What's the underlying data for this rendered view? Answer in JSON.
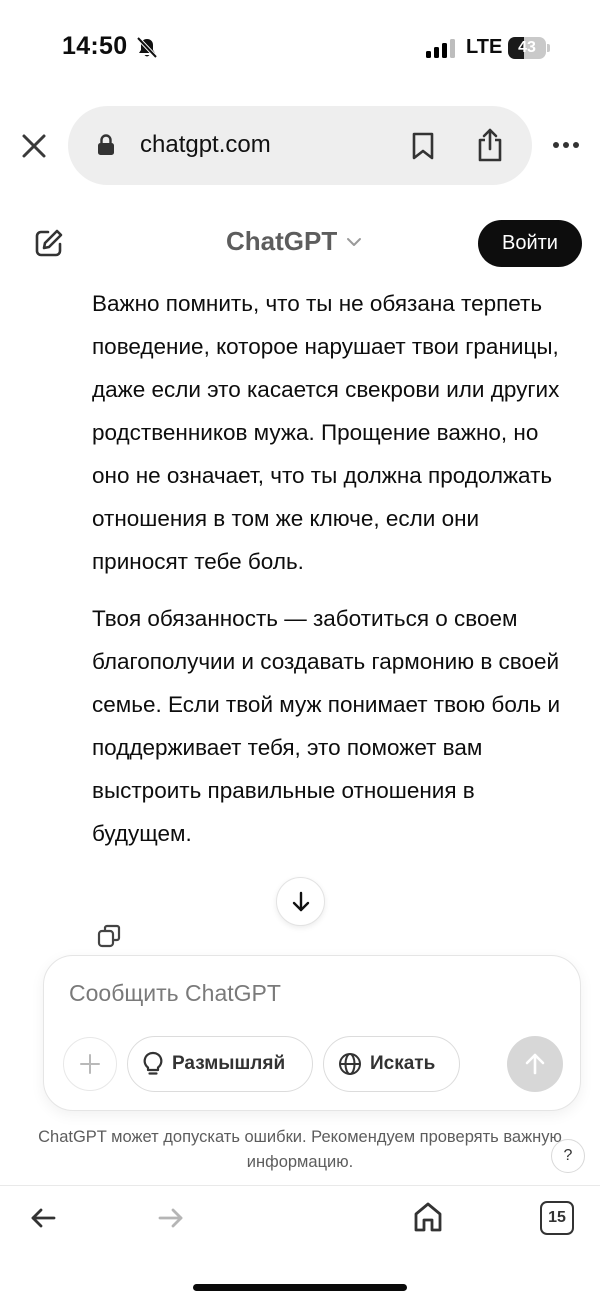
{
  "status_bar": {
    "time": "14:50",
    "network": "LTE",
    "battery_level": "43",
    "battery_fraction": 0.43
  },
  "browser": {
    "url": "chatgpt.com",
    "open_tabs": "15"
  },
  "header": {
    "title": "ChatGPT",
    "login_label": "Войти"
  },
  "message": {
    "paragraphs": [
      "Важно помнить, что ты не обязана терпеть поведение, которое нарушает твои границы, даже если это касается свекрови или других родственников мужа. Прощение важно, но оно не означает, что ты должна продолжать отношения в том же ключе, если они приносят тебе боль.",
      "Твоя обязанность — заботиться о своем благополучии и создавать гармонию в своей семье. Если твой муж понимает твою боль и поддерживает тебя, это поможет вам выстроить правильные отношения в будущем."
    ]
  },
  "composer": {
    "placeholder": "Сообщить ChatGPT",
    "think_label": "Размышляй",
    "search_label": "Искать"
  },
  "footer": {
    "disclaimer": "ChatGPT может допускать ошибки. Рекомендуем проверять важную информацию.",
    "help_label": "?"
  },
  "icons": {
    "close": "close-icon",
    "lock": "lock-icon",
    "bookmark": "bookmark-icon",
    "share": "share-icon",
    "more": "more-icon",
    "new_chat": "edit-icon",
    "chevron": "chevron-down-icon",
    "scroll_down": "arrow-down-icon",
    "copy": "copy-icon",
    "plus": "plus-icon",
    "bulb": "lightbulb-icon",
    "globe": "globe-icon",
    "send": "arrow-up-icon",
    "back": "arrow-left-icon",
    "forward": "arrow-right-icon",
    "home": "home-icon",
    "bell_off": "bell-slash-icon"
  },
  "colors": {
    "login_button": "#0d0d0d",
    "urlbar_bg": "#eeeeee",
    "send_button_disabled": "#d7d7d7"
  }
}
